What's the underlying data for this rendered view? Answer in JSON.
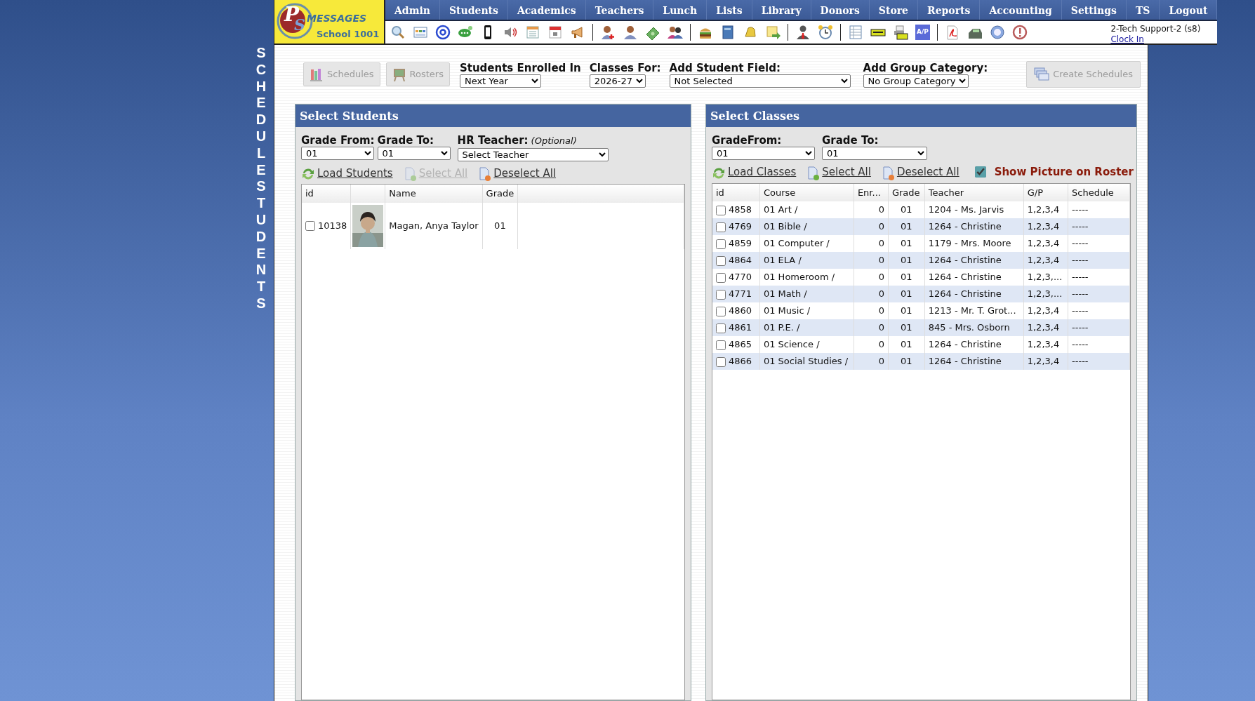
{
  "side_title": "SCHEDULE STUDENTS",
  "logo": {
    "letters": [
      "P",
      "S"
    ],
    "name": "MESSAGES",
    "school": "School 1001"
  },
  "menu": [
    "Admin",
    "Students",
    "Academics",
    "Teachers",
    "Lunch",
    "Lists",
    "Library",
    "Donors",
    "Store",
    "Reports",
    "Accounting",
    "Settings",
    "TS",
    "Logout"
  ],
  "toolbar_badge": "A/P",
  "user": {
    "name": "2-Tech Support-2 (s8)",
    "link": "Clock In"
  },
  "top_buttons": [
    {
      "label": "Schedules",
      "kind": "books",
      "disabled": true
    },
    {
      "label": "Rosters",
      "kind": "easel",
      "disabled": true
    }
  ],
  "filters": [
    {
      "label": "Students Enrolled In",
      "value": "Next Year"
    },
    {
      "label": "Classes For:",
      "value": "2026-27"
    },
    {
      "label": "Add Student Field:",
      "value": "Not Selected"
    },
    {
      "label": "Add Group Category:",
      "value": "No Group Category"
    }
  ],
  "create_button": {
    "label": "Create Schedules",
    "disabled": true
  },
  "students_panel": {
    "title": "Select Students",
    "filters": [
      {
        "label": "Grade From:",
        "value": "01"
      },
      {
        "label": "Grade To:",
        "value": "01"
      },
      {
        "label": "HR Teacher:",
        "note": "(Optional)",
        "value": "Select Teacher"
      }
    ],
    "actions": [
      {
        "label": "Load Students",
        "kind": "reload",
        "disabled": false
      },
      {
        "label": "Select All",
        "kind": "add",
        "disabled": true
      },
      {
        "label": "Deselect All",
        "kind": "remove",
        "disabled": false
      }
    ],
    "columns": [
      "id",
      "Name",
      "Grade"
    ],
    "rows": [
      {
        "id": "10138",
        "name": "Magan, Anya Taylor",
        "grade": "01",
        "checked": false
      }
    ]
  },
  "classes_panel": {
    "title": "Select Classes",
    "filters": [
      {
        "label": "GradeFrom:",
        "value": "01"
      },
      {
        "label": "Grade To:",
        "value": "01"
      }
    ],
    "actions": [
      {
        "label": "Load Classes",
        "kind": "reload",
        "disabled": false
      },
      {
        "label": "Select All",
        "kind": "add",
        "disabled": false
      },
      {
        "label": "Deselect All",
        "kind": "remove",
        "disabled": false
      }
    ],
    "show_picture": {
      "label": "Show Picture on Roster",
      "checked": true
    },
    "columns": [
      "id",
      "Course",
      "Enr...",
      "Grade",
      "Teacher",
      "G/P",
      "Schedule"
    ],
    "rows": [
      {
        "id": "4858",
        "course": "01 Art /",
        "enrolled": "0",
        "grade": "01",
        "teacher": "1204 - Ms. Jarvis",
        "gp": "1,2,3,4",
        "schedule": "-----",
        "checked": false
      },
      {
        "id": "4769",
        "course": "01 Bible /",
        "enrolled": "0",
        "grade": "01",
        "teacher": "1264 - Christine",
        "gp": "1,2,3,4",
        "schedule": "-----",
        "checked": false
      },
      {
        "id": "4859",
        "course": "01 Computer /",
        "enrolled": "0",
        "grade": "01",
        "teacher": "1179 - Mrs. Moore",
        "gp": "1,2,3,4",
        "schedule": "-----",
        "checked": false
      },
      {
        "id": "4864",
        "course": "01 ELA /",
        "enrolled": "0",
        "grade": "01",
        "teacher": "1264 - Christine",
        "gp": "1,2,3,4",
        "schedule": "-----",
        "checked": false
      },
      {
        "id": "4770",
        "course": "01 Homeroom /",
        "enrolled": "0",
        "grade": "01",
        "teacher": "1264 - Christine",
        "gp": "1,2,3,...",
        "schedule": "-----",
        "checked": false
      },
      {
        "id": "4771",
        "course": "01 Math /",
        "enrolled": "0",
        "grade": "01",
        "teacher": "1264 - Christine",
        "gp": "1,2,3,...",
        "schedule": "-----",
        "checked": false
      },
      {
        "id": "4860",
        "course": "01 Music /",
        "enrolled": "0",
        "grade": "01",
        "teacher": "1213 - Mr. T. Grot...",
        "gp": "1,2,3,4",
        "schedule": "-----",
        "checked": false
      },
      {
        "id": "4861",
        "course": "01 P.E. /",
        "enrolled": "0",
        "grade": "01",
        "teacher": "845 - Mrs. Osborn",
        "gp": "1,2,3,4",
        "schedule": "-----",
        "checked": false
      },
      {
        "id": "4865",
        "course": "01 Science /",
        "enrolled": "0",
        "grade": "01",
        "teacher": "1264 - Christine",
        "gp": "1,2,3,4",
        "schedule": "-----",
        "checked": false
      },
      {
        "id": "4866",
        "course": "01 Social Studies /",
        "enrolled": "0",
        "grade": "01",
        "teacher": "1264 - Christine",
        "gp": "1,2,3,4",
        "schedule": "-----",
        "checked": false
      }
    ]
  }
}
